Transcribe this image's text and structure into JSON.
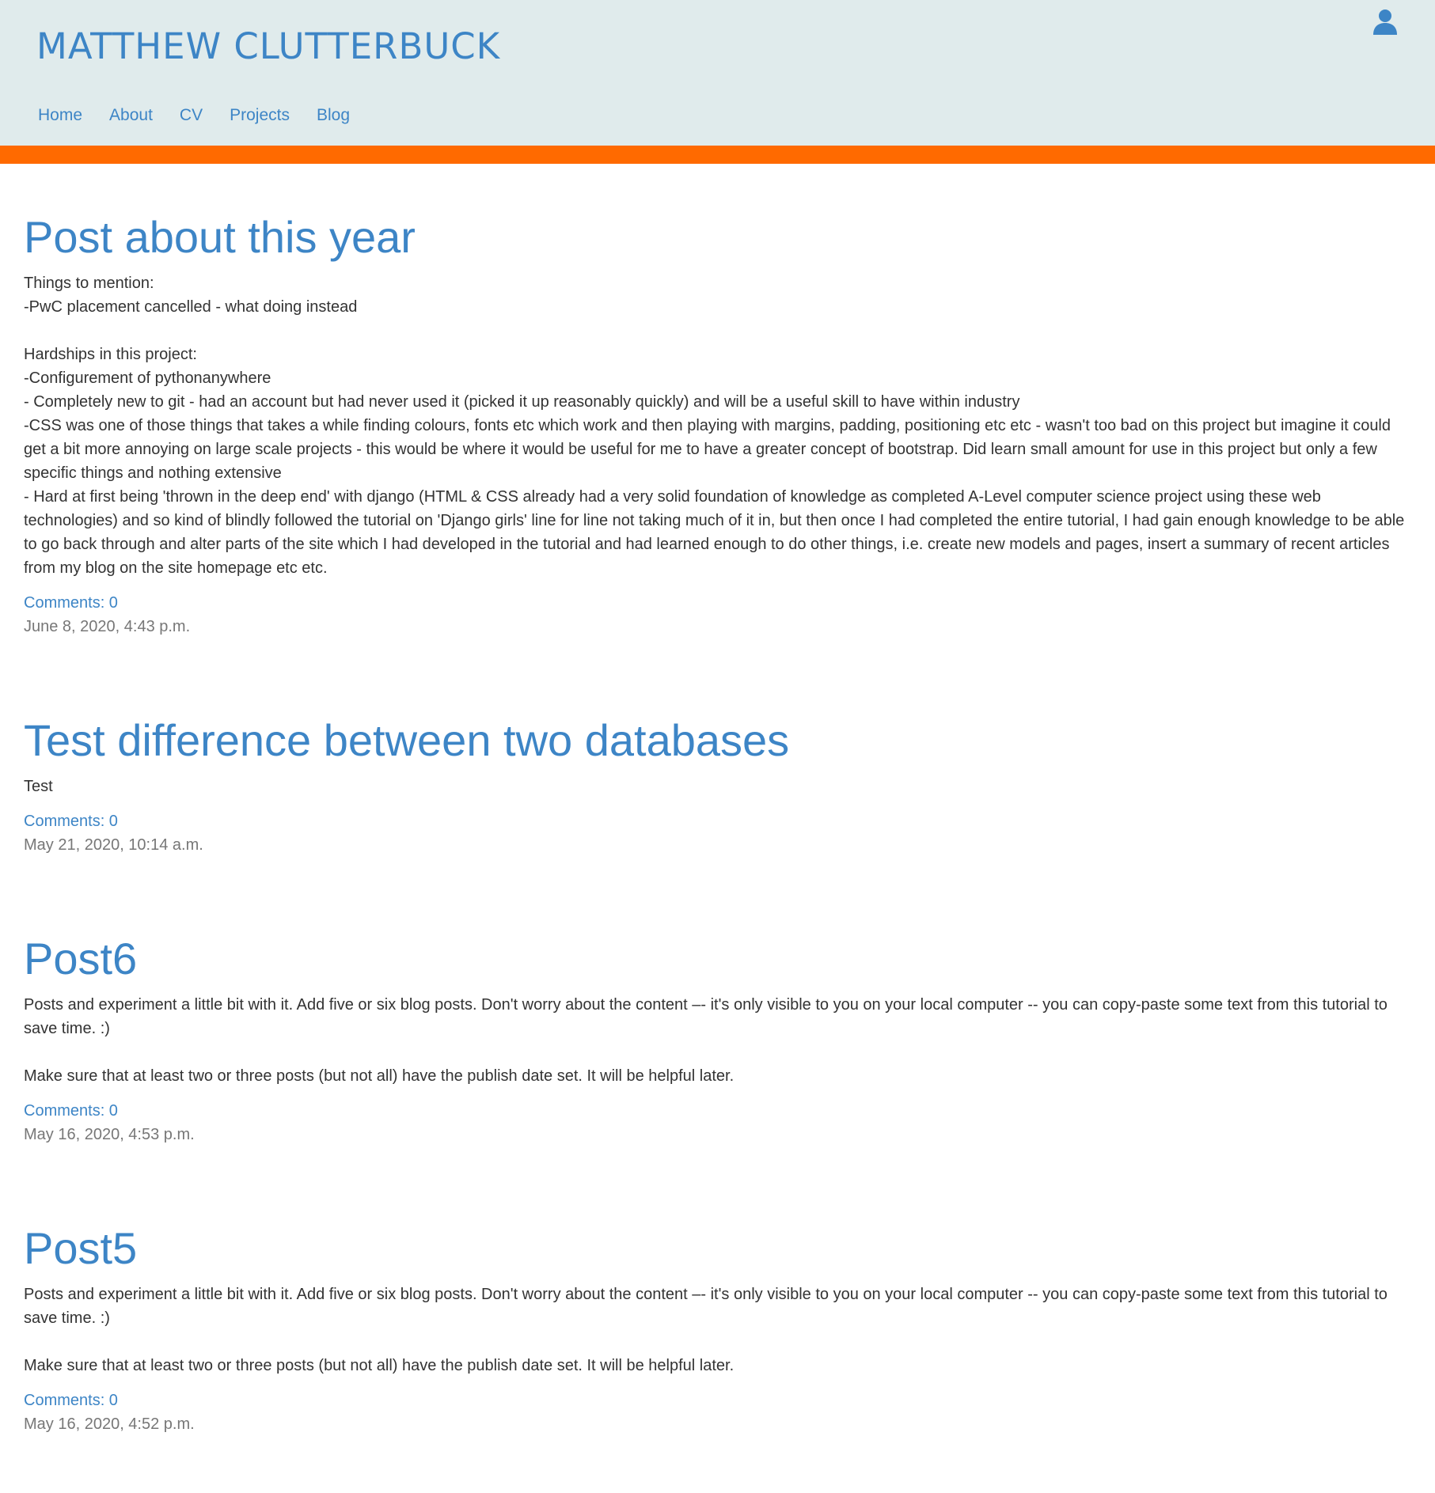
{
  "header": {
    "site_title": "MATTHEW CLUTTERBUCK",
    "nav": [
      {
        "label": "Home"
      },
      {
        "label": "About"
      },
      {
        "label": "CV"
      },
      {
        "label": "Projects"
      },
      {
        "label": "Blog"
      }
    ],
    "user_icon": "user-icon"
  },
  "colors": {
    "header_bg": "#e0ebec",
    "accent_bar": "#ff6a00",
    "link": "#3d85c6",
    "text": "#333333",
    "date": "#777777"
  },
  "posts": [
    {
      "title": "Post about this year",
      "text": "Things to mention:\n-PwC placement cancelled - what doing instead\n\nHardships in this project:\n-Configurement of pythonanywhere\n- Completely new to git - had an account but had never used it (picked it up reasonably quickly) and will be a useful skill to have within industry\n-CSS was one of those things that takes a while finding colours, fonts etc which work and then playing with margins, padding, positioning etc etc - wasn't too bad on this project but imagine it could get a bit more annoying on large scale projects - this would be where it would be useful for me to have a greater concept of bootstrap. Did learn small amount for use in this project but only a few specific things and nothing extensive\n- Hard at first being 'thrown in the deep end' with django (HTML & CSS already had a very solid foundation of knowledge as completed A-Level computer science project using these web technologies) and so kind of blindly followed the tutorial on 'Django girls' line for line not taking much of it in, but then once I had completed the entire tutorial, I had gain enough knowledge to be able to go back through and alter parts of the site which I had developed in the tutorial and had learned enough to do other things, i.e. create new models and pages, insert a summary of recent articles from my blog on the site homepage etc etc.",
      "comments": "Comments: 0",
      "date": "June 8, 2020, 4:43 p.m."
    },
    {
      "title": "Test difference between two databases",
      "text": "Test",
      "comments": "Comments: 0",
      "date": "May 21, 2020, 10:14 a.m."
    },
    {
      "title": "Post6",
      "text": "Posts and experiment a little bit with it. Add five or six blog posts. Don't worry about the content –- it's only visible to you on your local computer -- you can copy-paste some text from this tutorial to save time. :)\n\nMake sure that at least two or three posts (but not all) have the publish date set. It will be helpful later.",
      "comments": "Comments: 0",
      "date": "May 16, 2020, 4:53 p.m."
    },
    {
      "title": "Post5",
      "text": "Posts and experiment a little bit with it. Add five or six blog posts. Don't worry about the content –- it's only visible to you on your local computer -- you can copy-paste some text from this tutorial to save time. :)\n\nMake sure that at least two or three posts (but not all) have the publish date set. It will be helpful later.",
      "comments": "Comments: 0",
      "date": "May 16, 2020, 4:52 p.m."
    }
  ]
}
